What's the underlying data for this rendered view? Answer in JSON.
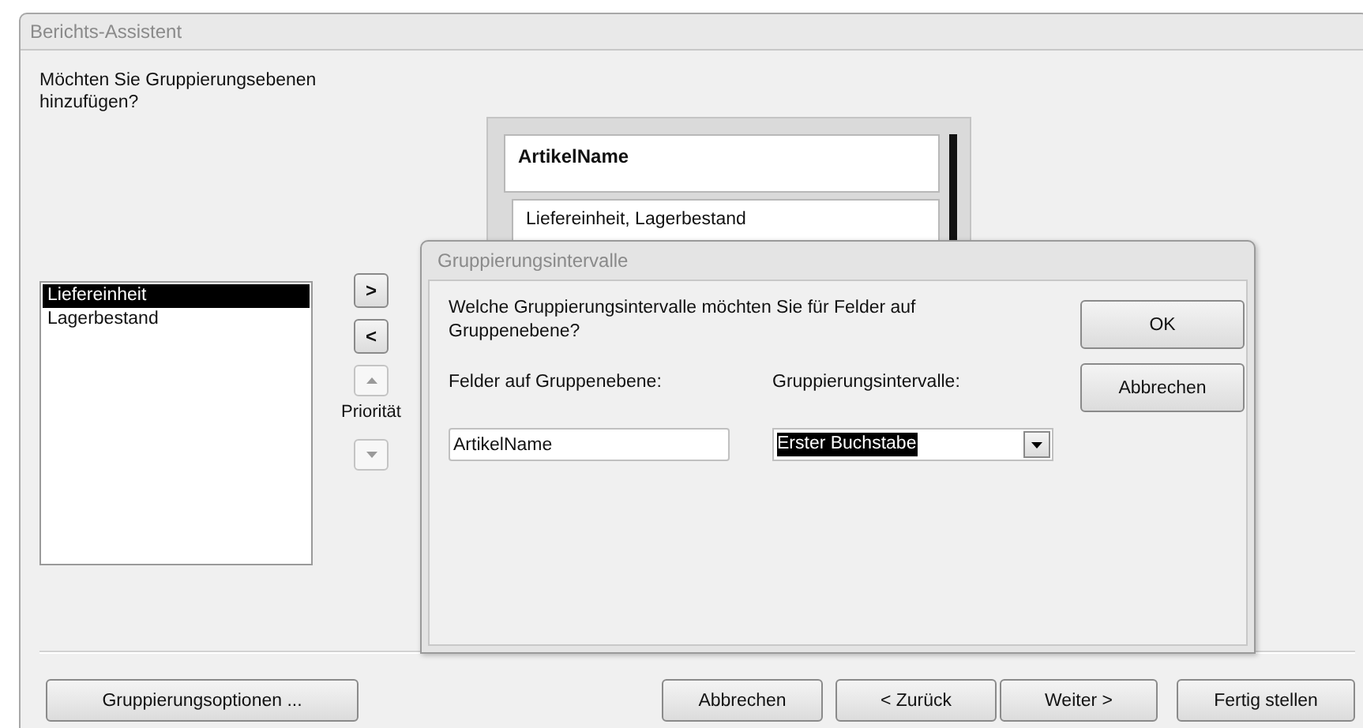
{
  "window": {
    "title": "Berichts-Assistent"
  },
  "question": "Möchten Sie Gruppierungsebenen hinzufügen?",
  "fields": [
    {
      "label": "Liefereinheit",
      "selected": true
    },
    {
      "label": "Lagerbestand",
      "selected": false
    }
  ],
  "move_buttons": [
    {
      "label": ">",
      "disabled": false
    },
    {
      "label": "<",
      "disabled": false
    }
  ],
  "priority": {
    "label": "Priorität",
    "buttons": [
      {
        "kind": "up",
        "disabled": true
      },
      {
        "kind": "down",
        "disabled": true
      }
    ]
  },
  "preview": {
    "group_header": "ArtikelName",
    "detail": "Liefereinheit, Lagerbestand"
  },
  "dialog": {
    "title": "Gruppierungsintervalle",
    "question": "Welche Gruppierungsintervalle möchten Sie für Felder auf Gruppenebene?",
    "field_label": "Felder auf Gruppenebene:",
    "interval_label": "Gruppierungsintervalle:",
    "field_value": "ArtikelName",
    "interval_value": "Erster Buchstabe",
    "buttons": [
      {
        "label": "OK"
      },
      {
        "label": "Abbrechen"
      }
    ]
  },
  "buttons": [
    {
      "label": "Gruppierungsoptionen ..."
    },
    {
      "label": "Abbrechen"
    },
    {
      "label": "< Zurück"
    },
    {
      "label": "Weiter >"
    },
    {
      "label": "Fertig stellen"
    }
  ]
}
